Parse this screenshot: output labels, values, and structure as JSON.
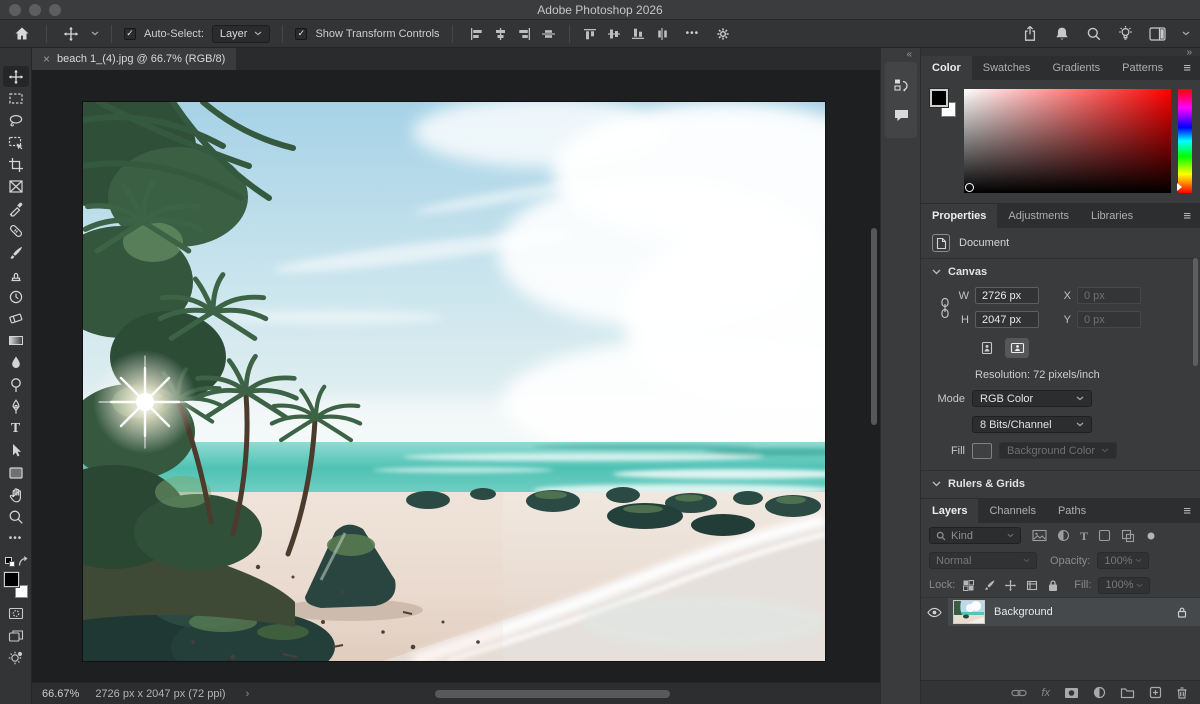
{
  "titlebar": {
    "title": "Adobe Photoshop 2026"
  },
  "options_bar": {
    "auto_select_label": "Auto-Select:",
    "auto_select_value": "Layer",
    "show_transform_label": "Show Transform Controls"
  },
  "document_tab": {
    "title": "beach 1_(4).jpg @ 66.7% (RGB/8)"
  },
  "toolbar": {
    "selected_tool": "move",
    "tools": [
      "move",
      "rectangular-marquee",
      "lasso",
      "object-selection",
      "crop",
      "frame",
      "eyedropper",
      "spot-healing-brush",
      "brush",
      "clone-stamp",
      "history-brush",
      "eraser",
      "gradient",
      "blur",
      "dodge",
      "pen",
      "type",
      "path-selection",
      "rectangle-shape",
      "hand",
      "zoom"
    ],
    "foreground_color": "#000000",
    "background_color": "#ffffff"
  },
  "color_panel": {
    "tabs": [
      "Color",
      "Swatches",
      "Gradients",
      "Patterns"
    ],
    "active_tab": "Color",
    "foreground_color": "#000000",
    "background_color": "#ffffff",
    "hue": "#ff0000"
  },
  "properties_panel": {
    "tabs": [
      "Properties",
      "Adjustments",
      "Libraries"
    ],
    "active_tab": "Properties",
    "document_label": "Document",
    "canvas": {
      "section_label": "Canvas",
      "w_label": "W",
      "w_value": "2726 px",
      "x_label": "X",
      "x_value": "0 px",
      "h_label": "H",
      "h_value": "2047 px",
      "y_label": "Y",
      "y_value": "0 px",
      "resolution": "Resolution: 72 pixels/inch",
      "mode_label": "Mode",
      "mode_value": "RGB Color",
      "bit_depth_value": "8 Bits/Channel",
      "fill_label": "Fill",
      "fill_value": "Background Color"
    },
    "rulers_section_label": "Rulers & Grids"
  },
  "layers_panel": {
    "tabs": [
      "Layers",
      "Channels",
      "Paths"
    ],
    "active_tab": "Layers",
    "kind_filter_label": "Kind",
    "blend_mode": "Normal",
    "opacity_label": "Opacity:",
    "opacity_value": "100%",
    "lock_label": "Lock:",
    "fill_label": "Fill:",
    "fill_value": "100%",
    "layers": [
      {
        "name": "Background",
        "visible": true,
        "locked": true
      }
    ]
  },
  "status_bar": {
    "zoom_level": "66.67%",
    "doc_size": "2726 px x 2047 px (72 ppi)"
  },
  "icons": {
    "close": "×",
    "check": "✓",
    "collapse_left": "«",
    "collapse_right": "»",
    "menu": "≡",
    "more": "•••",
    "chevron_right": "›",
    "type_tool": "T",
    "fx": "fx"
  },
  "colors": {
    "panel_bg": "#3a3b3c",
    "recess_bg": "#2c2d2e",
    "pasteboard_bg": "#1e1f20",
    "selected_layer_bg": "#46494c",
    "hue_red": "#ff0000"
  }
}
